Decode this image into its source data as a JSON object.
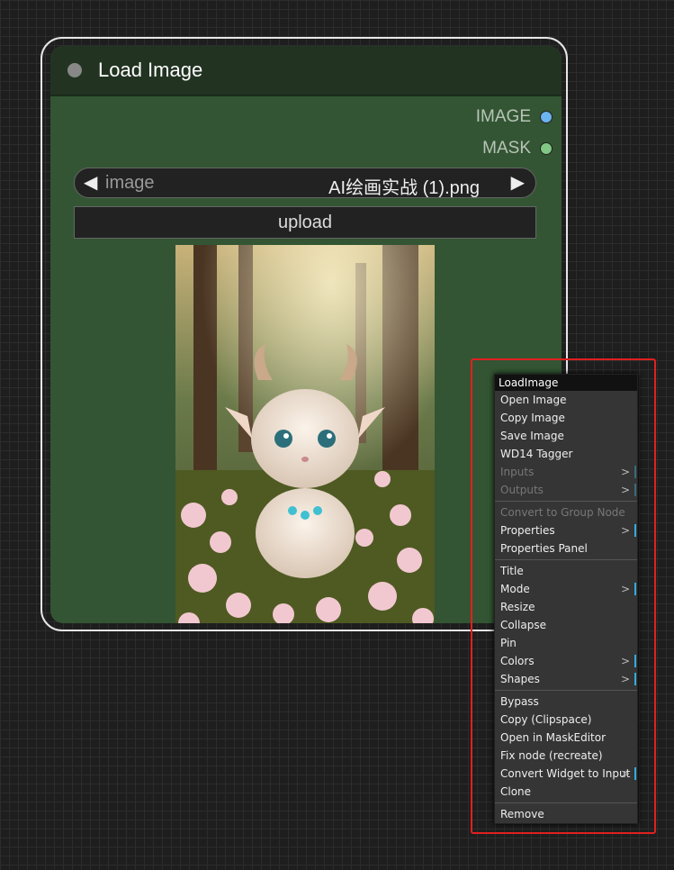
{
  "node": {
    "title": "Load Image",
    "outputs": [
      {
        "label": "IMAGE",
        "color": "#6bb4f0"
      },
      {
        "label": "MASK",
        "color": "#81c784"
      }
    ],
    "image_widget": {
      "label": "image",
      "value": "AI绘画实战 (1).png"
    },
    "upload_label": "upload"
  },
  "context_menu": {
    "title": "LoadImage",
    "groups": [
      [
        {
          "label": "Open Image"
        },
        {
          "label": "Copy Image"
        },
        {
          "label": "Save Image"
        },
        {
          "label": "WD14 Tagger"
        },
        {
          "label": "Inputs",
          "disabled": true,
          "submenu": true
        },
        {
          "label": "Outputs",
          "disabled": true,
          "submenu": true
        }
      ],
      [
        {
          "label": "Convert to Group Node",
          "disabled": true
        },
        {
          "label": "Properties",
          "submenu": true
        },
        {
          "label": "Properties Panel"
        }
      ],
      [
        {
          "label": "Title"
        },
        {
          "label": "Mode",
          "submenu": true
        },
        {
          "label": "Resize"
        },
        {
          "label": "Collapse"
        },
        {
          "label": "Pin"
        },
        {
          "label": "Colors",
          "submenu": true
        },
        {
          "label": "Shapes",
          "submenu": true
        }
      ],
      [
        {
          "label": "Bypass"
        },
        {
          "label": "Copy (Clipspace)"
        },
        {
          "label": "Open in MaskEditor"
        },
        {
          "label": "Fix node (recreate)"
        },
        {
          "label": "Convert Widget to Input",
          "submenu": true
        },
        {
          "label": "Clone"
        }
      ],
      [
        {
          "label": "Remove"
        }
      ]
    ]
  },
  "icons": {
    "combo_left": "triangle-left-icon",
    "combo_right": "triangle-right-icon",
    "submenu": ">"
  },
  "colors": {
    "node_body": "#335533",
    "node_header": "#223322",
    "highlight": "#e02020"
  }
}
